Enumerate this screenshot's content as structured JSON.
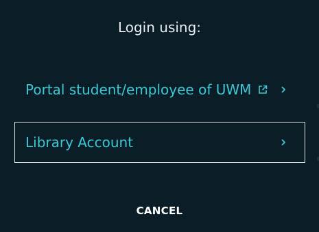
{
  "dialog": {
    "title": "Login using:",
    "options": [
      {
        "label": "Portal student/employee of UWM",
        "icons": [
          "external-link-icon",
          "chevron-right-icon"
        ]
      },
      {
        "label": "Library Account",
        "icons": [
          "chevron-right-icon"
        ]
      }
    ],
    "cancel_label": "CANCEL"
  },
  "colors": {
    "background": "#0b1e28",
    "accent": "#3ec8d4",
    "title_text": "#e8edf0",
    "border": "#e6e6e6"
  }
}
